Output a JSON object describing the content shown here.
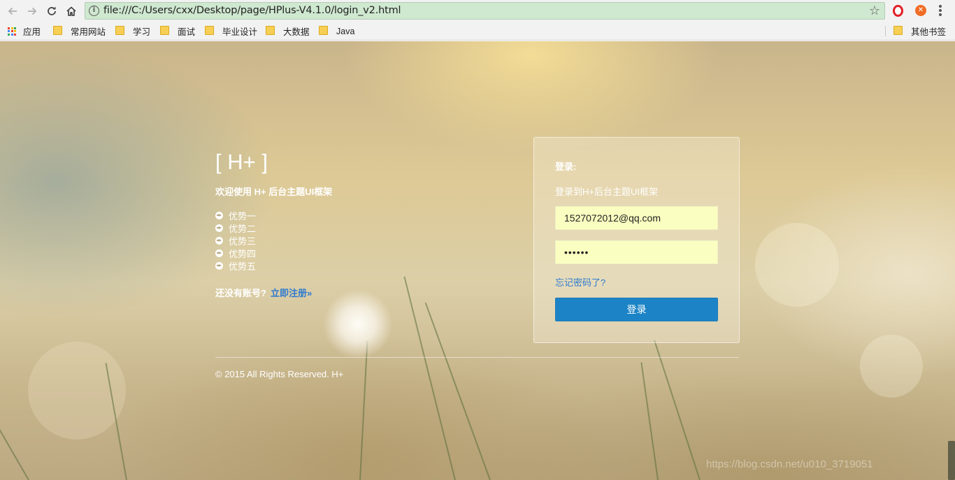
{
  "browser": {
    "url": "file:///C:/Users/cxx/Desktop/page/HPlus-V4.1.0/login_v2.html",
    "bookmarks": [
      {
        "label": "应用",
        "icon": "apps-grid-icon"
      },
      {
        "label": "常用网站",
        "icon": "folder-icon"
      },
      {
        "label": "学习",
        "icon": "folder-icon"
      },
      {
        "label": "面试",
        "icon": "folder-icon"
      },
      {
        "label": "毕业设计",
        "icon": "folder-icon"
      },
      {
        "label": "大数据",
        "icon": "folder-icon"
      },
      {
        "label": "Java",
        "icon": "folder-icon"
      }
    ],
    "other_bookmarks": "其他书签",
    "colors": {
      "omnibox": "#cfe8d0",
      "folder": "#f7cf55"
    }
  },
  "page": {
    "brand": "[ H+ ]",
    "welcome": "欢迎使用 H+ 后台主题UI框架",
    "features": [
      "优势一",
      "优势二",
      "优势三",
      "优势四",
      "优势五"
    ],
    "register_prompt": "还没有账号?",
    "register_link": "立即注册»",
    "login": {
      "title": "登录:",
      "subtitle": "登录到H+后台主题UI框架",
      "email": "1527072012@qq.com",
      "password_mask": "••••••",
      "forgot": "忘记密码了?",
      "submit": "登录"
    },
    "footer": "© 2015 All Rights Reserved. H+",
    "watermark": "https://blog.csdn.net/u010_3719051",
    "colors": {
      "link": "#2f7ad0",
      "button": "#1c84c6",
      "input_bg": "#fafec0"
    }
  }
}
